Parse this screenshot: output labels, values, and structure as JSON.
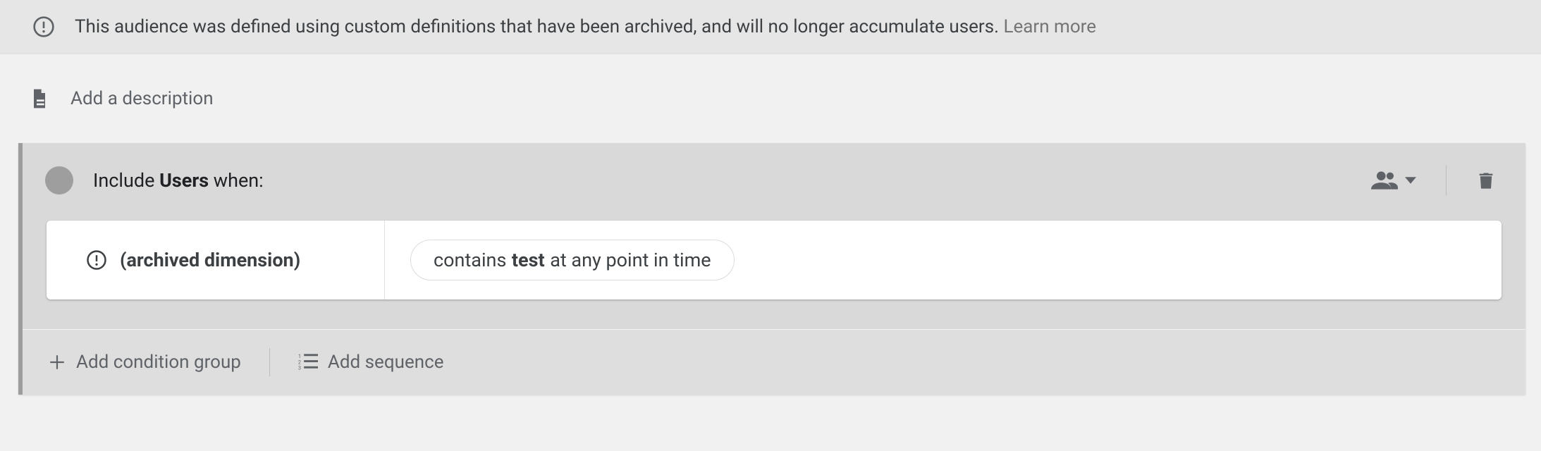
{
  "warning": {
    "message": "This audience was defined using custom definitions that have been archived, and will no longer accumulate users.",
    "learn_more": "Learn more"
  },
  "description": {
    "placeholder": "Add a description"
  },
  "builder": {
    "header": {
      "prefix": "Include ",
      "scope_word": "Users",
      "suffix": " when:"
    },
    "condition": {
      "dimension_label": "(archived dimension)",
      "chip_prefix": "contains ",
      "chip_value": "test",
      "chip_suffix": " at any point in time"
    },
    "footer": {
      "add_condition_group": "Add condition group",
      "add_sequence": "Add sequence"
    }
  }
}
